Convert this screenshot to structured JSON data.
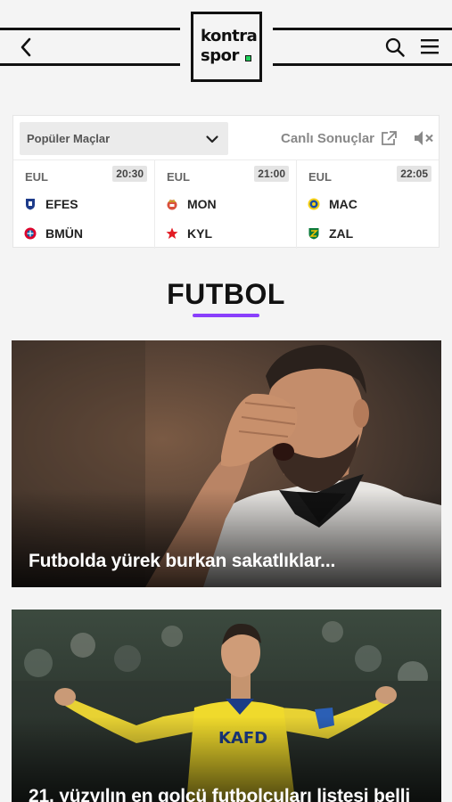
{
  "header": {
    "logo_line1": "kontra",
    "logo_line2": "spor"
  },
  "scores": {
    "dropdown_label": "Popüler Maçlar",
    "live_results_label": "Canlı Sonuçlar",
    "games": [
      {
        "league": "EUL",
        "time": "20:30",
        "home": "EFES",
        "away": "BMÜN"
      },
      {
        "league": "EUL",
        "time": "21:00",
        "home": "MON",
        "away": "KYL"
      },
      {
        "league": "EUL",
        "time": "22:05",
        "home": "MAC",
        "away": "ZAL"
      }
    ]
  },
  "section": {
    "title": "FUTBOL"
  },
  "articles": [
    {
      "headline": "Futbolda yürek burkan sakatlıklar..."
    },
    {
      "headline": "21. yüzyılın en golcü futbolcuları listesi belli"
    }
  ],
  "colors": {
    "accent": "#8a3ffc",
    "logo_dot": "#1fcf5a"
  }
}
